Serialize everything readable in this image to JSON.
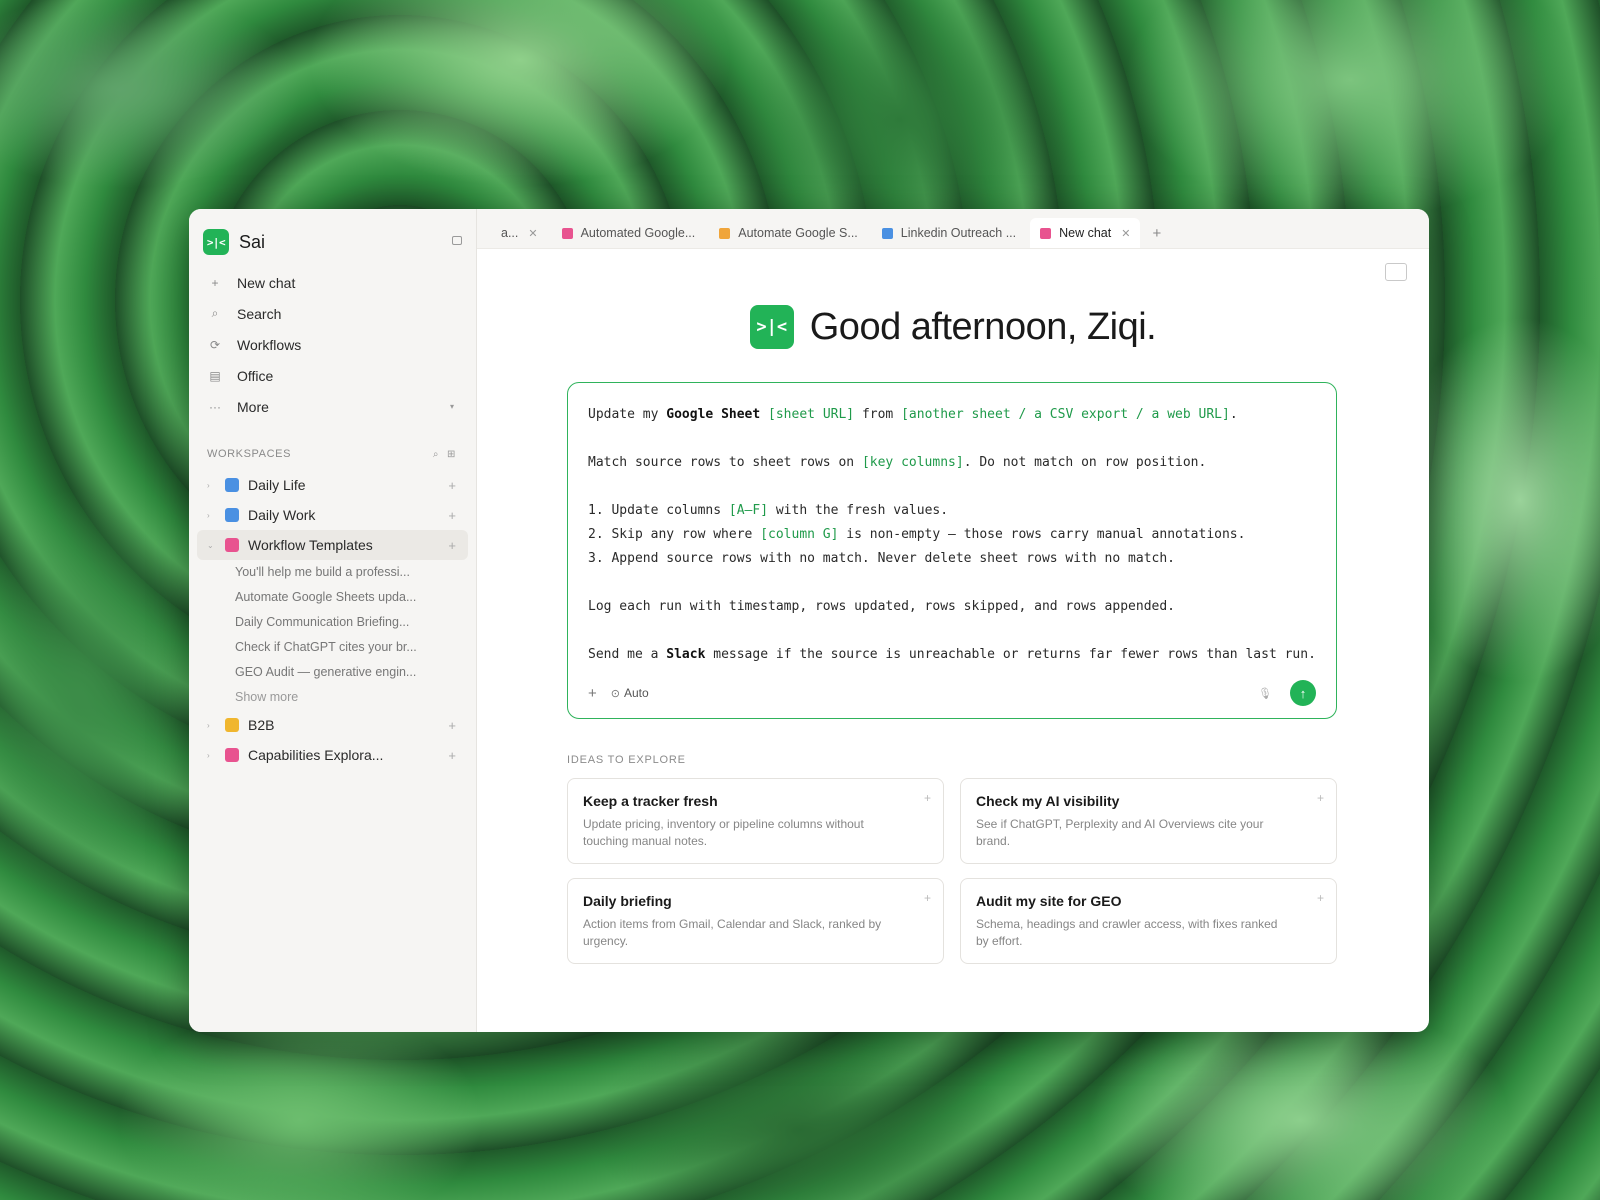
{
  "app": {
    "name": "Sai",
    "logo_text": ">|<"
  },
  "sidebar": {
    "nav": [
      {
        "icon": "+",
        "label": "New chat"
      },
      {
        "icon": "⌕",
        "label": "Search"
      },
      {
        "icon": "⟳",
        "label": "Workflows"
      },
      {
        "icon": "▤",
        "label": "Office"
      },
      {
        "icon": "···",
        "label": "More"
      }
    ],
    "workspaces_label": "WORKSPACES",
    "workspaces": [
      {
        "label": "Daily Life",
        "color": "#4a90e2"
      },
      {
        "label": "Daily Work",
        "color": "#4a90e2"
      },
      {
        "label": "Workflow Templates",
        "color": "#e8538f"
      },
      {
        "label": "B2B",
        "color": "#f0b62e"
      },
      {
        "label": "Capabilities Explora...",
        "color": "#e8538f"
      }
    ],
    "workflow_items": [
      "You'll help me build a professi...",
      "Automate Google Sheets upda...",
      "Daily Communication Briefing...",
      "Check if ChatGPT cites your br...",
      "GEO Audit — generative engin..."
    ],
    "show_more": "Show more"
  },
  "tabs": [
    {
      "label": "a...",
      "color": "",
      "closable": true
    },
    {
      "label": "Automated Google...",
      "color": "#e8538f"
    },
    {
      "label": "Automate Google S...",
      "color": "#f0a53a"
    },
    {
      "label": "Linkedin Outreach ...",
      "color": "#4a90e2"
    },
    {
      "label": "New chat",
      "color": "#e8538f",
      "active": true,
      "closable": true
    }
  ],
  "greeting": "Good afternoon, Ziqi.",
  "composer": {
    "lines": {
      "l1a": "Update my ",
      "l1b": "Google Sheet",
      "l1c": " ",
      "l1d": "[sheet URL]",
      "l1e": " from ",
      "l1f": "[another sheet / a CSV export / a web URL]",
      "l1g": ".",
      "l2a": "Match source rows to sheet rows on ",
      "l2b": "[key columns]",
      "l2c": ". Do not match on row position.",
      "l3a": "1. Update columns ",
      "l3b": "[A–F]",
      "l3c": " with the fresh values.",
      "l4a": "2. Skip any row where ",
      "l4b": "[column G]",
      "l4c": " is non-empty — those rows carry manual annotations.",
      "l5": "3. Append source rows with no match. Never delete sheet rows with no match.",
      "l6": "Log each run with timestamp, rows updated, rows skipped, and rows appended.",
      "l7a": "Send me a ",
      "l7b": "Slack",
      "l7c": " message if the source is unreachable or returns far fewer rows than last run."
    },
    "mode": "Auto"
  },
  "ideas_title": "IDEAS TO EXPLORE",
  "ideas": [
    {
      "title": "Keep a tracker fresh",
      "desc": "Update pricing, inventory or pipeline columns without touching manual notes."
    },
    {
      "title": "Check my AI visibility",
      "desc": "See if ChatGPT, Perplexity and AI Overviews cite your brand."
    },
    {
      "title": "Daily briefing",
      "desc": "Action items from Gmail, Calendar and Slack, ranked by urgency."
    },
    {
      "title": "Audit my site for GEO",
      "desc": "Schema, headings and crawler access, with fixes ranked by effort."
    }
  ]
}
